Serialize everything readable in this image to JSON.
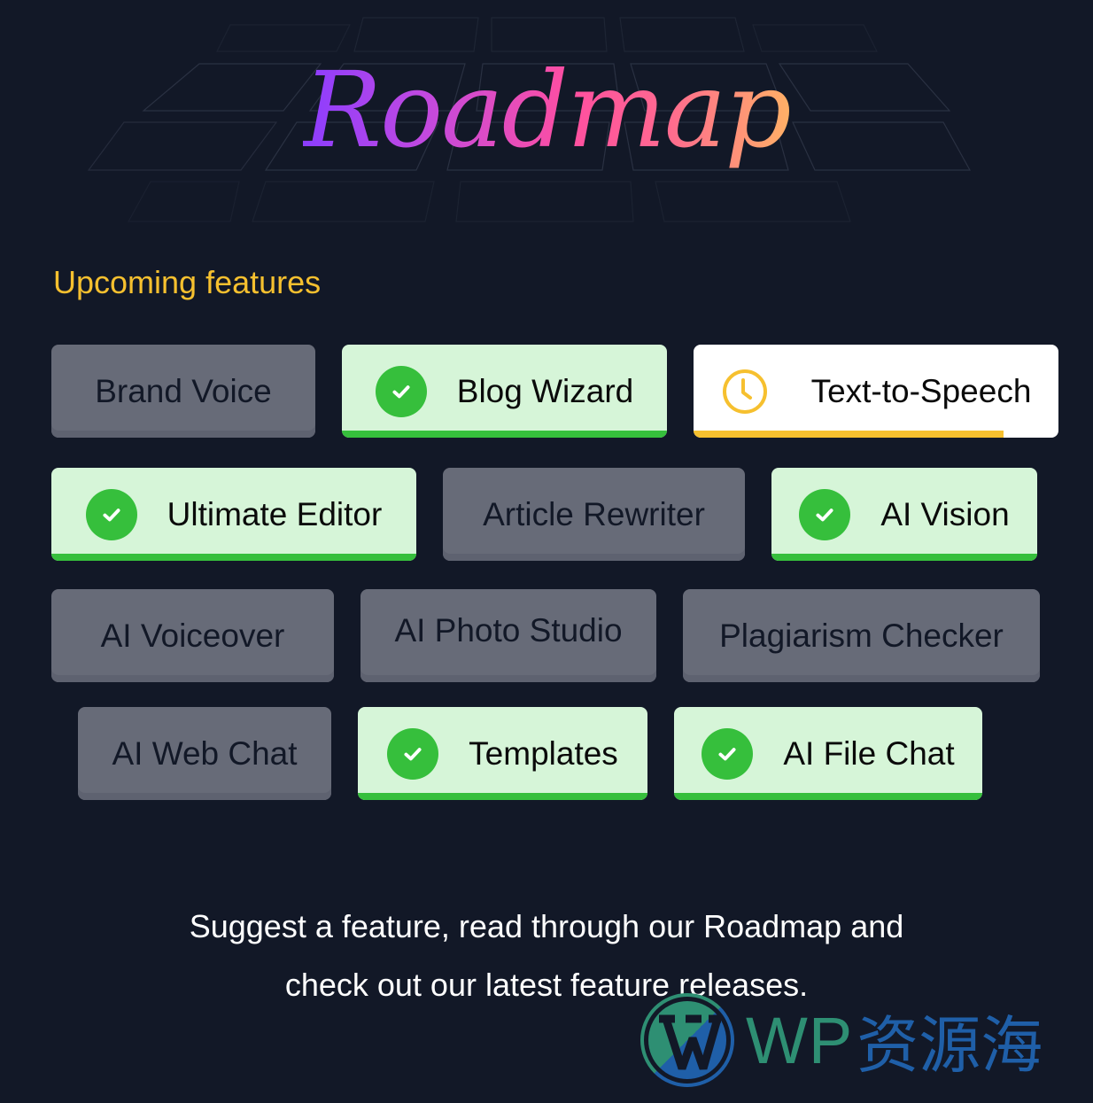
{
  "hero": {
    "title": "Roadmap"
  },
  "section": {
    "title": "Upcoming features"
  },
  "features": [
    {
      "label": "Brand Voice",
      "status": "pending"
    },
    {
      "label": "Blog Wizard",
      "status": "done",
      "icon": "check-circle-icon"
    },
    {
      "label": "Text-to-Speech",
      "status": "in-progress",
      "icon": "clock-icon",
      "progress_percent": 85
    },
    {
      "label": "Ultimate Editor",
      "status": "done",
      "icon": "check-circle-icon"
    },
    {
      "label": "Article Rewriter",
      "status": "pending"
    },
    {
      "label": "AI Vision",
      "status": "done",
      "icon": "check-circle-icon"
    },
    {
      "label": "AI Voiceover",
      "status": "pending"
    },
    {
      "label": "AI Photo Studio",
      "status": "pending"
    },
    {
      "label": "Plagiarism Checker",
      "status": "pending"
    },
    {
      "label": "AI Web Chat",
      "status": "pending"
    },
    {
      "label": "Templates",
      "status": "done",
      "icon": "check-circle-icon"
    },
    {
      "label": "AI File Chat",
      "status": "done",
      "icon": "check-circle-icon"
    }
  ],
  "footer": {
    "line1": "Suggest a feature, read through our Roadmap and",
    "line2": "check out our latest feature releases."
  },
  "watermark": {
    "latin": "WP",
    "cjk": "资源海"
  },
  "colors": {
    "background": "#121827",
    "accent_yellow": "#f6c02f",
    "done_green": "#36bf3c",
    "done_bg": "#d6f5d8",
    "pending_bg": "#676b78",
    "gradient_start": "#8b3dff",
    "gradient_mid": "#ff4fa0",
    "gradient_end": "#ffb066"
  }
}
